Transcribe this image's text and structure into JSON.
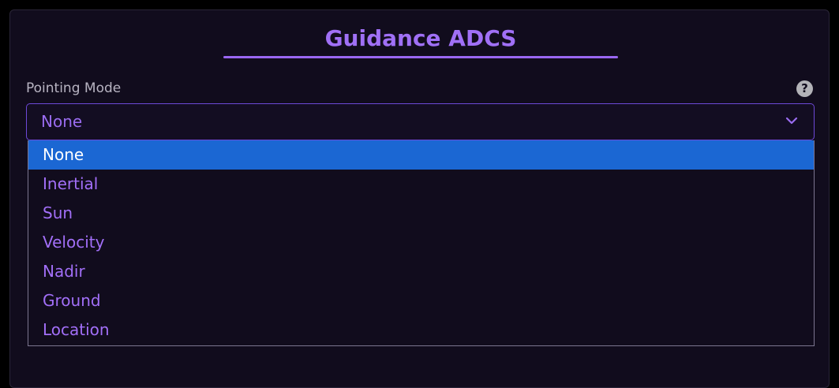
{
  "panel": {
    "title": "Guidance ADCS"
  },
  "pointing_mode": {
    "label": "Pointing Mode",
    "help_glyph": "?",
    "selected_value": "None",
    "options": [
      "None",
      "Inertial",
      "Sun",
      "Velocity",
      "Nadir",
      "Ground",
      "Location"
    ]
  },
  "colors": {
    "accent": "#a070f6",
    "selected_option_bg": "#1b67d3",
    "panel_bg": "#110c1d"
  },
  "icons": {
    "help": "question-circle-icon",
    "dropdown": "chevron-down-icon"
  }
}
